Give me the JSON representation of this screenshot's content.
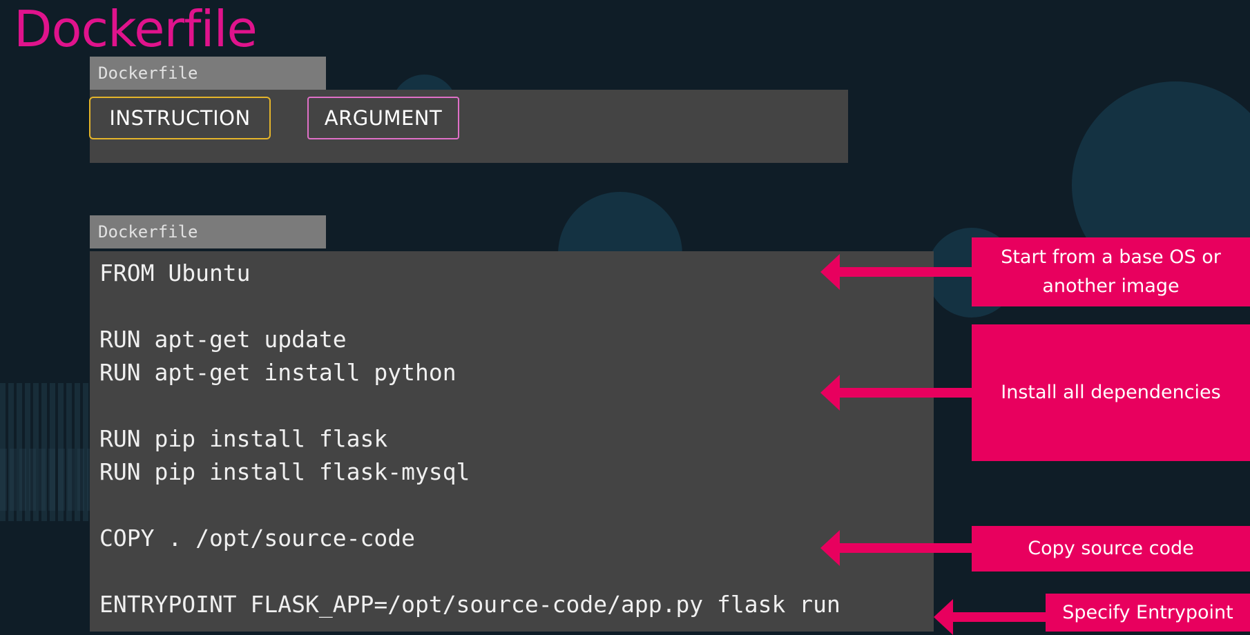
{
  "title": "Dockerfile",
  "legend": {
    "file_label": "Dockerfile",
    "instruction_label": "INSTRUCTION",
    "argument_label": "ARGUMENT"
  },
  "code": {
    "file_label": "Dockerfile",
    "lines": [
      "FROM Ubuntu",
      "",
      "RUN apt-get update",
      "RUN apt-get install python",
      "",
      "RUN pip install flask",
      "RUN pip install flask-mysql",
      "",
      "COPY . /opt/source-code",
      "",
      "ENTRYPOINT FLASK_APP=/opt/source-code/app.py flask run"
    ]
  },
  "callouts": {
    "base_os": "Start from a base OS or another image",
    "dependencies": "Install all dependencies",
    "copy": "Copy source code",
    "entrypoint": "Specify Entrypoint"
  },
  "colors": {
    "title": "#e0138c",
    "callout": "#e8005e",
    "instruction_border": "#e5b52a",
    "argument_border": "#e070c8",
    "panel": "#444444",
    "background": "#0f1d27"
  }
}
